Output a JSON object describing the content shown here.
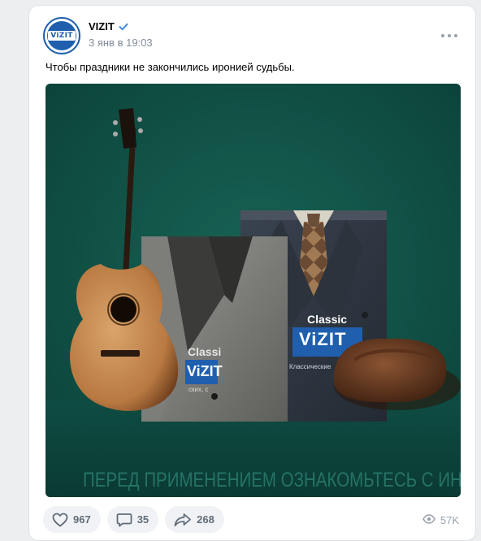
{
  "post": {
    "author": "VIZIT",
    "avatar_logo": "ViZIT",
    "date": "3 янв в 19:03",
    "text": "Чтобы праздники не закончились иронией судьбы.",
    "image": {
      "caption": "ПЕРЕД ПРИМЕНЕНИЕМ ОЗНАКОМЬТЕСЬ С ИНСТРУКЦИЕЙ",
      "pack_front_brand": "Classic",
      "pack_logo": "ViZIT",
      "pack_back_text": "Classi",
      "pack_small_text": "Классические",
      "pack_left_small": "ских, с"
    },
    "likes": "967",
    "comments": "35",
    "reposts": "268",
    "views": "57K"
  },
  "colors": {
    "accent": "#1f5fae",
    "image_bg": "#10544a",
    "meta_text": "#818c99"
  },
  "icons": {
    "verified": "verified-check-icon",
    "more": "more-dots-icon",
    "like": "heart-icon",
    "comment": "comment-icon",
    "repost": "share-arrow-icon",
    "views": "eye-icon"
  }
}
